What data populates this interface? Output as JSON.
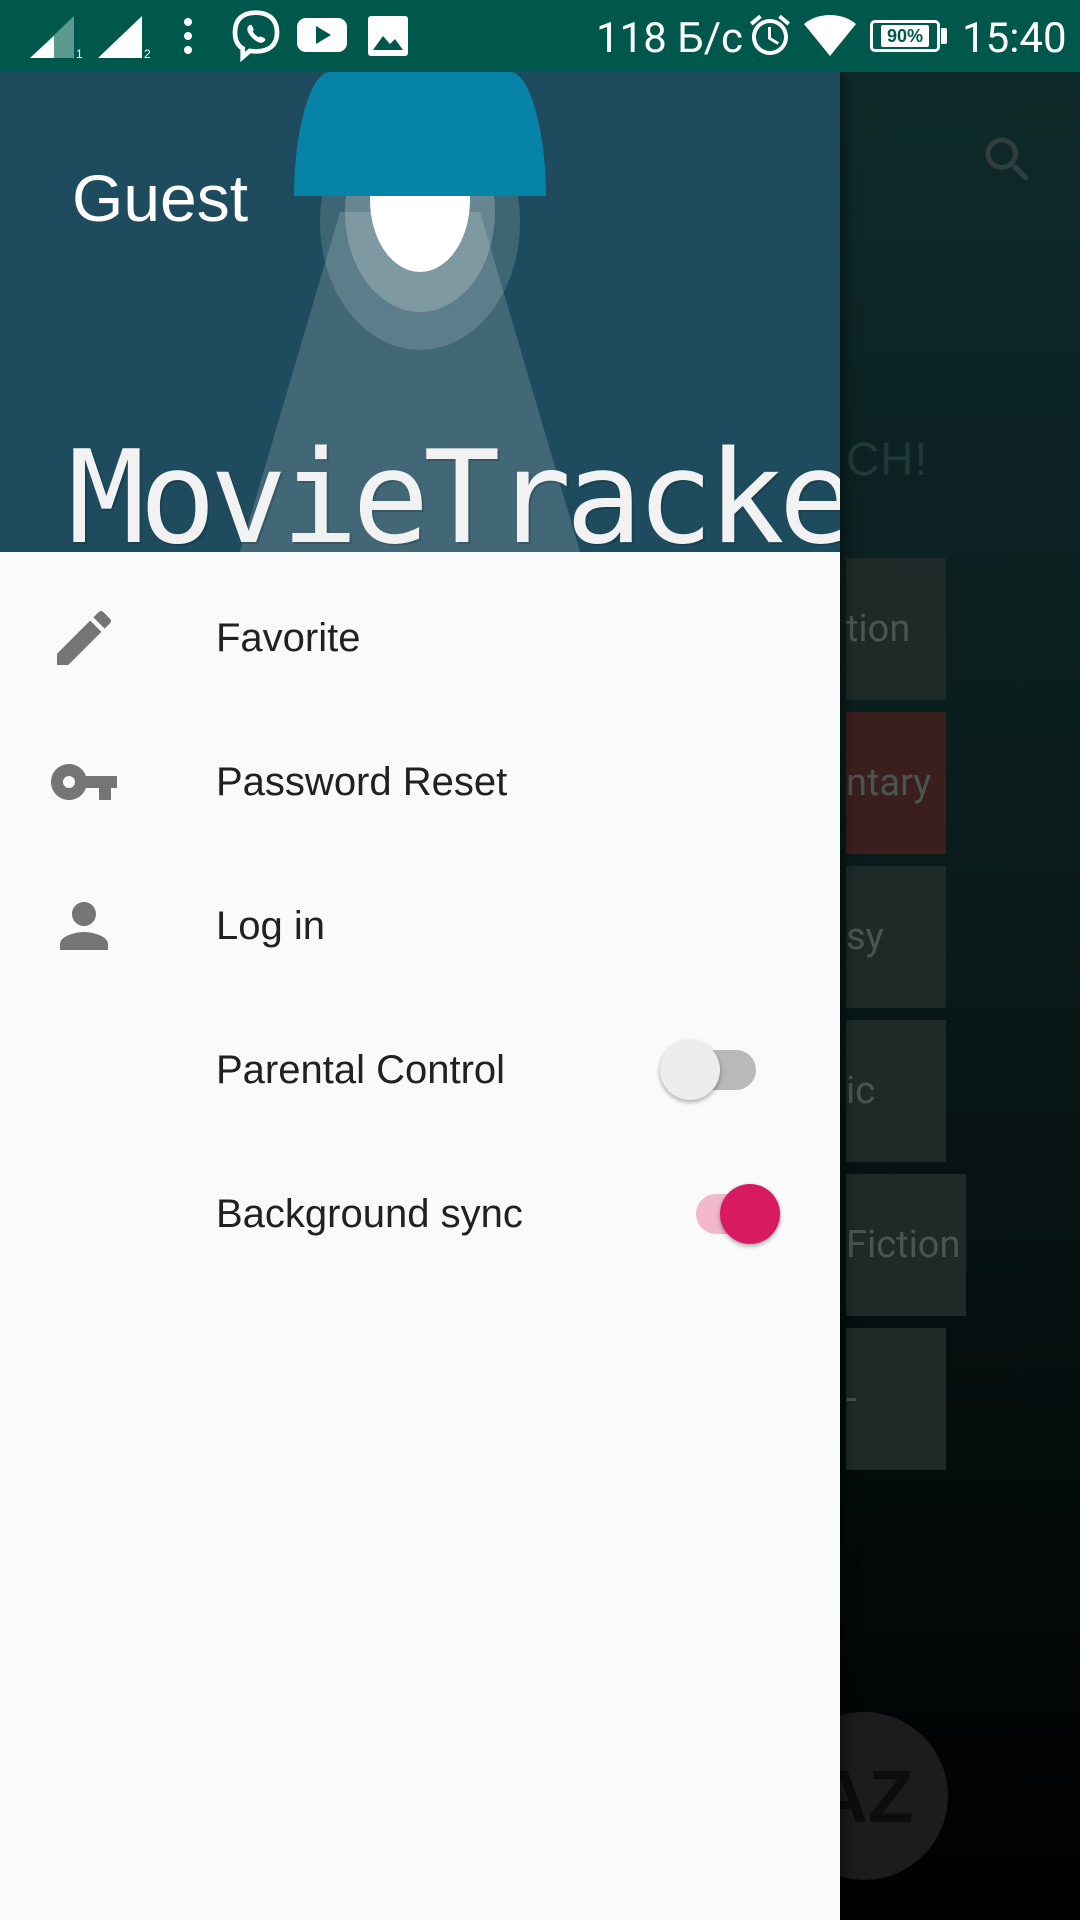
{
  "status_bar": {
    "network_speed": "118 Б/с",
    "battery": "90%",
    "time": "15:40",
    "icons": [
      "signal-sim1-icon",
      "signal-sim2-icon",
      "more-vert-icon",
      "viber-icon",
      "youtube-icon",
      "gallery-icon",
      "alarm-icon",
      "wifi-icon",
      "battery-icon"
    ],
    "color": "#00574b"
  },
  "drawer": {
    "header": {
      "user_name": "Guest",
      "app_title": "MovieTracker",
      "background_color": "#1e4c5e",
      "lamp_color": "#0683a6"
    },
    "items": [
      {
        "label": "Favorite",
        "icon": "pencil-icon"
      },
      {
        "label": "Password Reset",
        "icon": "key-icon"
      },
      {
        "label": "Log in",
        "icon": "person-icon"
      },
      {
        "label": "Parental Control",
        "toggle": false
      },
      {
        "label": "Background sync",
        "toggle": true
      }
    ],
    "accent_color": "#d81b60"
  },
  "background_app": {
    "heading_fragment": "CH!",
    "cards": [
      "tion",
      "ntary",
      "sy",
      "ic",
      "Fiction",
      "-"
    ],
    "fab_label": "AZ"
  }
}
